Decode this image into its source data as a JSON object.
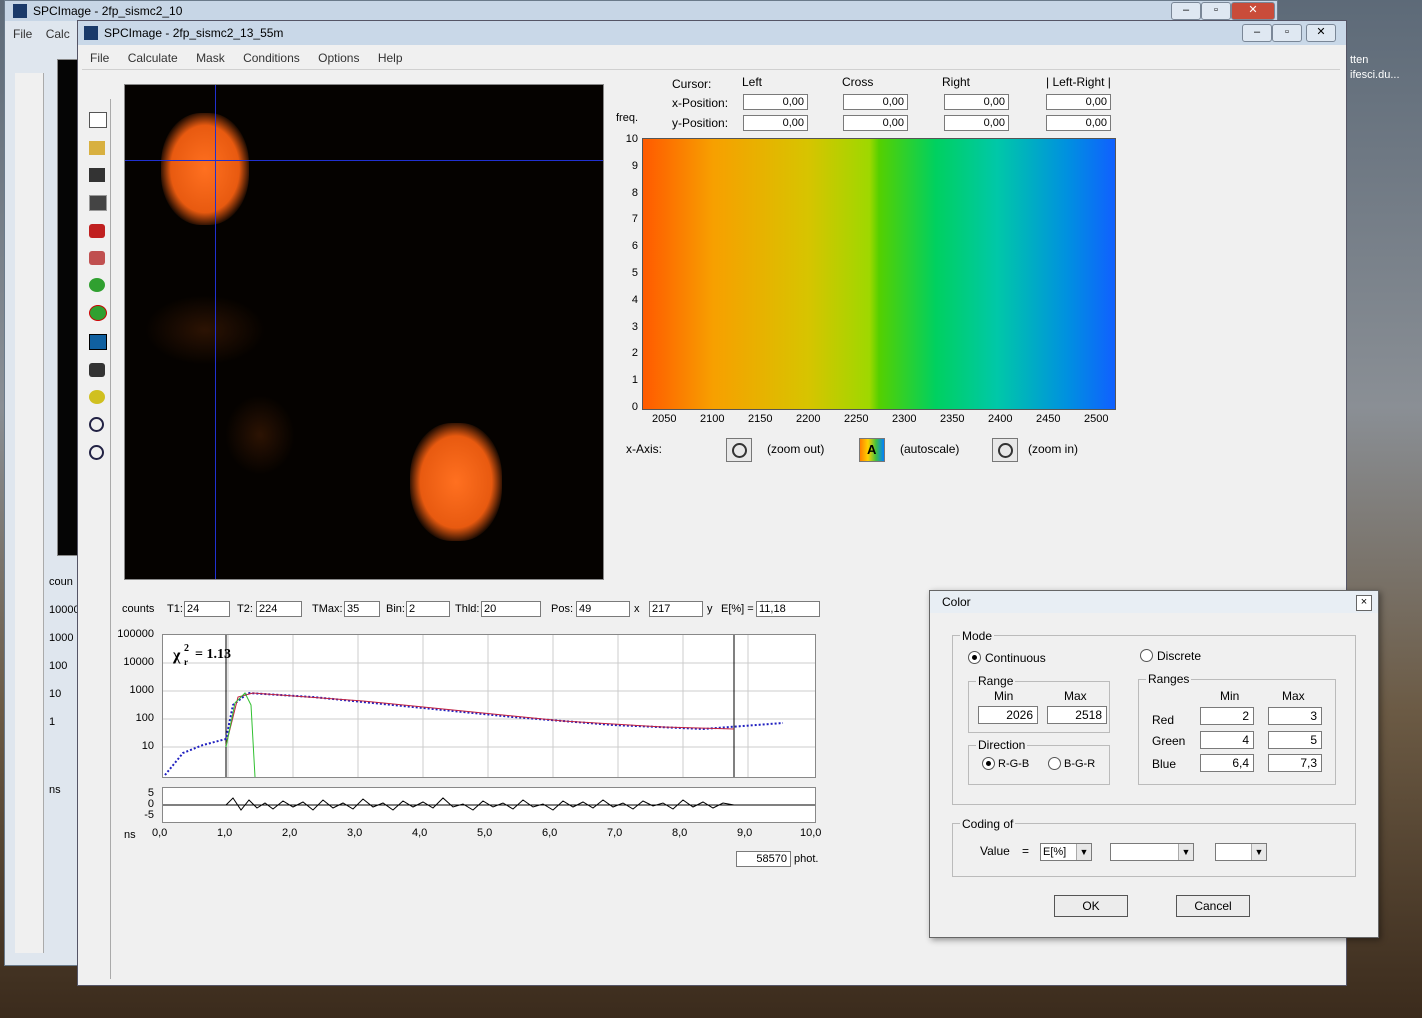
{
  "bg_window": {
    "title": "SPCImage - 2fp_sismc2_10",
    "menu": [
      "File",
      "Calc"
    ],
    "labels": [
      "coun",
      "10000",
      "1000",
      "100",
      "10",
      "1",
      "ns"
    ]
  },
  "main_window": {
    "title": "SPCImage - 2fp_sismc2_13_55m",
    "menu": [
      "File",
      "Calculate",
      "Mask",
      "Conditions",
      "Options",
      "Help"
    ]
  },
  "cursor_table": {
    "cursor_label": "Cursor:",
    "columns": [
      "Left",
      "Cross",
      "Right",
      "| Left-Right |"
    ],
    "xpos_label": "x-Position:",
    "ypos_label": "y-Position:",
    "x_values": [
      "0,00",
      "0,00",
      "0,00",
      "0,00"
    ],
    "y_values": [
      "0,00",
      "0,00",
      "0,00",
      "0,00"
    ]
  },
  "freq_plot": {
    "ylabel": "freq.",
    "yticks": [
      "10",
      "9",
      "8",
      "7",
      "6",
      "5",
      "4",
      "3",
      "2",
      "1",
      "0"
    ],
    "xticks": [
      "2050",
      "2100",
      "2150",
      "2200",
      "2250",
      "2300",
      "2350",
      "2400",
      "2450",
      "2500"
    ],
    "xaxis_label": "x-Axis:",
    "zoom_out": "(zoom out)",
    "autoscale": "(autoscale)",
    "zoom_in": "(zoom in)"
  },
  "decay_controls": {
    "counts": "counts",
    "t1_label": "T1:",
    "t1": "24",
    "t2_label": "T2:",
    "t2": "224",
    "tmax_label": "TMax:",
    "tmax": "35",
    "bin_label": "Bin:",
    "bin": "2",
    "thld_label": "Thld:",
    "thld": "20",
    "pos_label": "Pos:",
    "pos_x": "49",
    "x_label": "x",
    "pos_y": "217",
    "y_label": "y",
    "e_label": "E[%] =",
    "e_value": "11,18"
  },
  "decay_plot": {
    "yticks": [
      "100000",
      "10000",
      "1000",
      "100",
      "10"
    ],
    "chi": "χ",
    "chi_value": "=  1.13",
    "resid_ticks": [
      "5",
      "0",
      "-5"
    ],
    "ns": "ns",
    "xticks": [
      "0,0",
      "1,0",
      "2,0",
      "3,0",
      "4,0",
      "5,0",
      "6,0",
      "7,0",
      "8,0",
      "9,0",
      "10,0"
    ],
    "photons": "58570",
    "phot_label": "phot."
  },
  "color_dialog": {
    "title": "Color",
    "close": "×",
    "mode_label": "Mode",
    "continuous": "Continuous",
    "discrete": "Discrete",
    "range_label": "Range",
    "min_label": "Min",
    "max_label": "Max",
    "range_min": "2026",
    "range_max": "2518",
    "direction_label": "Direction",
    "rgb": "R-G-B",
    "bgr": "B-G-R",
    "ranges_label": "Ranges",
    "red": "Red",
    "green": "Green",
    "blue": "Blue",
    "red_min": "2",
    "red_max": "3",
    "green_min": "4",
    "green_max": "5",
    "blue_min": "6,4",
    "blue_max": "7,3",
    "coding_label": "Coding of",
    "value_label": "Value",
    "equals": "=",
    "coding_value": "E[%]",
    "ok": "OK",
    "cancel": "Cancel"
  },
  "desktop": {
    "text1": "tten",
    "text2": "ifesci.du..."
  }
}
